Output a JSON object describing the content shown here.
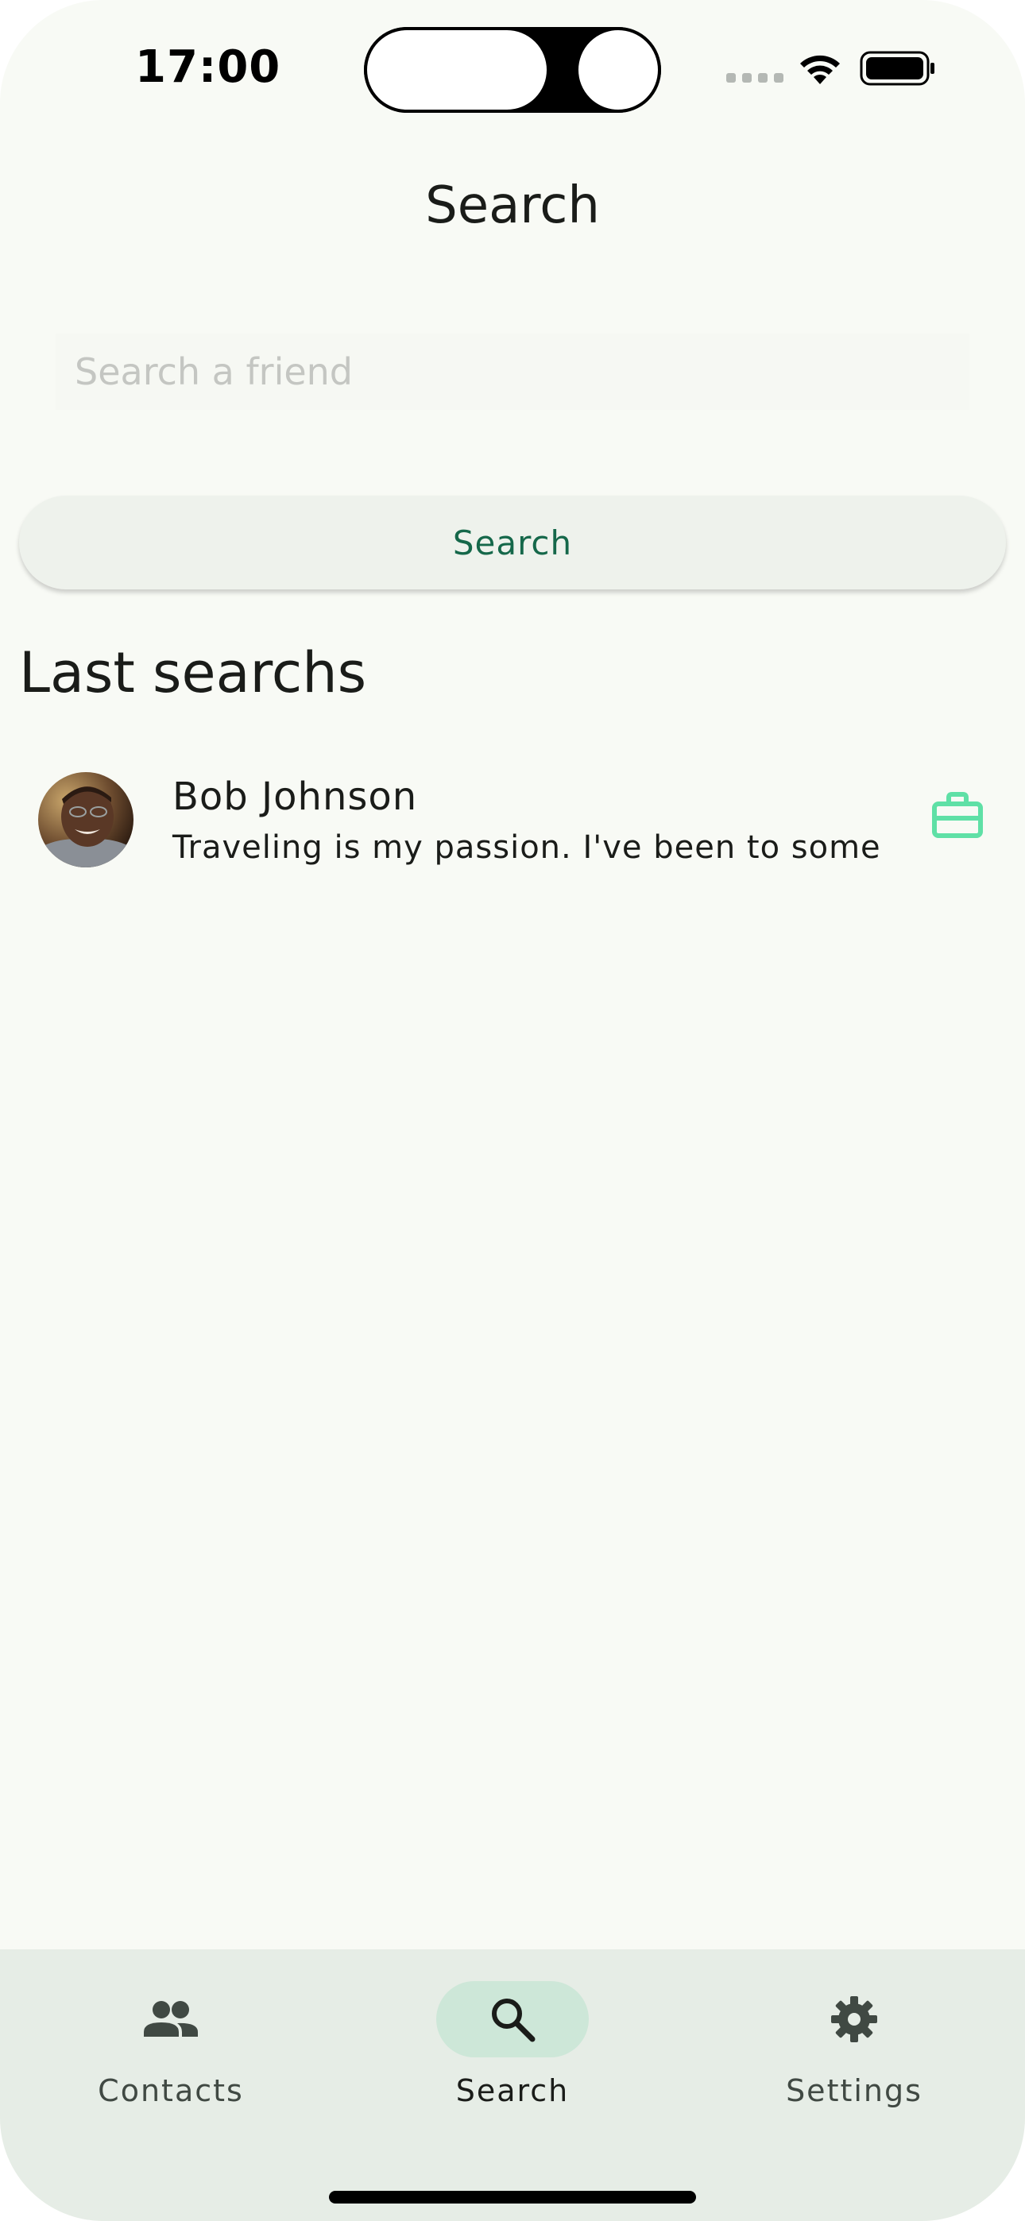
{
  "status_bar": {
    "time": "17:00"
  },
  "header": {
    "title": "Search"
  },
  "search": {
    "placeholder": "Search a friend",
    "value": "",
    "button_label": "Search"
  },
  "last_searches": {
    "heading": "Last searchs",
    "items": [
      {
        "name": "Bob Johnson",
        "description": "Traveling is my passion. I've been to some",
        "trailing_icon": "briefcase-icon"
      }
    ]
  },
  "bottom_nav": {
    "items": [
      {
        "label": "Contacts",
        "icon": "people-icon",
        "active": false
      },
      {
        "label": "Search",
        "icon": "search-icon",
        "active": true
      },
      {
        "label": "Settings",
        "icon": "gear-icon",
        "active": false
      }
    ]
  },
  "colors": {
    "background": "#f8faf5",
    "accent": "#15684a",
    "accent_container": "#cde7d8",
    "nav_background": "#e6ede6",
    "trailing_icon": "#5fe0a6"
  }
}
